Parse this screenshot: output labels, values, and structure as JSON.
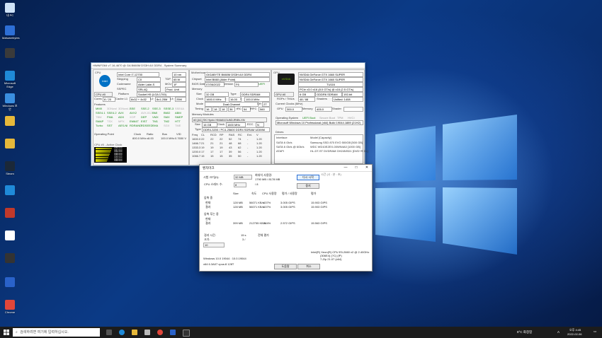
{
  "desktop": {
    "icons": [
      {
        "label": "내 PC",
        "color": "#cfe3f7"
      },
      {
        "label": "Malwarebytes",
        "color": "#2d6fd6"
      },
      {
        "label": "",
        "color": "#3a3a3a"
      },
      {
        "label": "Microsoft Edge",
        "color": "#1f8ad8"
      },
      {
        "label": "Windows 보안",
        "color": "#3a8fe0"
      },
      {
        "label": "",
        "color": "#e6b83a"
      },
      {
        "label": "",
        "color": "#e6b83a"
      },
      {
        "label": "Steam",
        "color": "#1b2838"
      },
      {
        "label": "",
        "color": "#1f8ad8"
      },
      {
        "label": "",
        "color": "#c0392b"
      },
      {
        "label": "",
        "color": "#ffffff"
      },
      {
        "label": "",
        "color": "#333333"
      },
      {
        "label": "",
        "color": "#2a62c9"
      },
      {
        "label": "Chrome",
        "color": "#e0463a"
      },
      {
        "label": "",
        "color": "#2a62c9"
      }
    ]
  },
  "hwinfo": {
    "title": "HWiNFO64 v7.16-4670 @ GA B660M DS3H AX DDR4 - System Summary",
    "cpu": {
      "header": "CPU",
      "name": "Intel Core i7-12700",
      "nm": "10 nm",
      "stepping": "Stepping",
      "stepping_val": "C0",
      "tdp_label": "TDP",
      "tdp": "65 W",
      "codename_label": "Codename",
      "codename": "Alder Lake-S",
      "mcu_label": "MCU",
      "mcu": "1F",
      "sspec_label": "SSPEC",
      "sspec": "SRL4Q",
      "prod_label": "Prod. Unit",
      "cpu_sel": "CPU #0",
      "platform_label": "Platform",
      "platform": "Socket H5 (LGA 1700)",
      "cores_label": "Cores",
      "cores": "8 / 20",
      "cache_label": "Cache L1",
      "cache_l1": "8x32 + 4x32",
      "l2_label": "L2",
      "l2": "8x1.25M",
      "l3_label": "L3",
      "l3": "25M",
      "features_label": "Features",
      "features": [
        "MMX",
        "3DNow!",
        "3DNow!-2",
        "SSE",
        "SSE-2",
        "SSE-3",
        "SSSE-3",
        "SSE4A",
        "SSE4.1",
        "SSE4.2",
        "AVX",
        "AVX2",
        "AVX-512",
        "BMI",
        "BMI2",
        "ABM",
        "TBM",
        "FMA",
        "ADX",
        "XOP",
        "DEP",
        "VMX",
        "SMX",
        "SMEP",
        "SMAP",
        "TSX",
        "MPX",
        "EM64T",
        "EIST",
        "TM1",
        "TM2",
        "HTT",
        "Turbo",
        "SST",
        "AES-NI",
        "RDRAND",
        "RDSEED",
        "SHA",
        "SGX",
        "TME"
      ],
      "op_point_label": "Operating Point",
      "clock_col": "Clock",
      "ratio_col": "Ratio",
      "bus_col": "Bus",
      "vid_col": "VID",
      "op_rows": [
        [
          "",
          "800.0 MHz",
          "x8.00",
          "100.0 MHz",
          "0.7650 V"
        ],
        [
          "",
          "2100.0 MHz",
          "x21.00",
          "100.0 MHz",
          ""
        ],
        [
          "",
          "4900.0 MHz",
          "x49.00",
          "100.0 MHz",
          ""
        ],
        [
          "",
          "4700.0 MHz",
          "x47.00",
          "100.0 MHz",
          "1.2880 V"
        ],
        [
          "",
          "4700.0 MHz",
          "x47.00",
          "99.8 MHz",
          ""
        ]
      ],
      "core_clock_label": "CPU #0 - Active Clock",
      "core_bars": [
        {
          "label": "Core 0",
          "value": "4988 MHz",
          "pct": 0.95
        },
        {
          "label": "Core 1",
          "value": "4987 MHz",
          "pct": 0.9
        },
        {
          "label": "Core 2",
          "value": "4988 MHz",
          "pct": 0.88
        },
        {
          "label": "Core 3",
          "value": "4988 MHz",
          "pct": 0.85
        },
        {
          "label": "Core 4",
          "value": "4988 MHz",
          "pct": 0.8
        },
        {
          "label": "Core 5",
          "value": "4988 MHz",
          "pct": 0.76
        },
        {
          "label": "Core 6",
          "value": "4988 MHz",
          "pct": 0.72
        },
        {
          "label": "Core 7",
          "value": "4988 MHz",
          "pct": 0.68
        }
      ]
    },
    "mobo": {
      "header": "Motherboard",
      "name": "GIGABYTE B660M DS3H AX DDR4",
      "chipset_label": "Chipset",
      "chipset": "Intel B660 (Alder Point)",
      "bios_label": "BIOS Date",
      "bios_date": "07/06/2022",
      "version_label": "Version",
      "version": "F6",
      "uefi": "UEFI",
      "memory_header": "Memory",
      "size_label": "Size",
      "size": "32 GB",
      "type_label": "Type",
      "type": "DDR4 SDRAM",
      "clock_label": "Clock",
      "clock": "1600.0 MHz",
      "eq": "=",
      "mult": "16.00",
      "x": "x",
      "base": "100.0 MHz",
      "mode_label": "Mode",
      "mode": "Dual-Channel",
      "cr_label": "CR",
      "cr": "2T",
      "timing_label": "Timing",
      "timings": [
        "16",
        "18",
        "18",
        "36"
      ],
      "trc_label": "tRC",
      "trc": "54",
      "trfc_label": "tRFC",
      "trfc": "560",
      "modules_header": "Memory Modules",
      "module_sel": "#0 [A1] SK Hynix HMA81GU6DJR8N-XN",
      "msize_label": "Size",
      "msize": "16 GB",
      "mclock_label": "Clock",
      "mclock": "1600 MHz",
      "ecc_label": "ECC",
      "ecc": "N",
      "mtype_label": "Type",
      "mtype": "DDR4-3200 / PC4-25600 DDR4 SDRAM UDIMM",
      "freq_cols": [
        "Freq",
        "CL",
        "RCD",
        "RP",
        "RAS",
        "RC",
        "Ext.",
        "V"
      ],
      "freq_rows": [
        [
          "1600.0",
          "22",
          "22",
          "22",
          "52",
          "74",
          "-",
          "1.20"
        ],
        [
          "1466.7",
          "21",
          "21",
          "21",
          "48",
          "68",
          "-",
          "1.20"
        ],
        [
          "1333.3",
          "19",
          "19",
          "19",
          "43",
          "62",
          "-",
          "1.20"
        ],
        [
          "1200.0",
          "17",
          "17",
          "17",
          "39",
          "56",
          "-",
          "1.20"
        ],
        [
          "1066.7",
          "15",
          "15",
          "15",
          "35",
          "50",
          "-",
          "1.20"
        ]
      ]
    },
    "gpu": {
      "header": "GPU",
      "name": "NVIDIA GeForce GTX 1660 SUPER",
      "sub": "NVIDIA GeForce GTX 1660 SUPER",
      "code": "TU116",
      "pcie": "PCIe v3.0 x16 (8.0 GT/s) @ x16 (2.5 GT/s)",
      "gpu_sel": "GPU #0",
      "vram": "6 GB",
      "vram_type": "GDDR6 SDRAM",
      "bus": "192-bit",
      "rops_label": "ROPs / TMUs",
      "rops": "48 / 88",
      "shaders_label": "Shaders",
      "shaders": "Unified: 1408",
      "clocks_label": "Current Clocks (MHz)",
      "gpu_clk_label": "GPU",
      "gpu_clk": "300.0",
      "mem_clk_label": "Memory",
      "mem_clk": "405.0",
      "shader_clk_label": "Shader",
      "shader_clk": "",
      "os_label": "Operating System",
      "uefi_boot": "UEFI Boot",
      "secure_boot": "Secure Boot",
      "tpm": "TPM",
      "hvci": "HVCI",
      "os": "Microsoft Windows 10 Professional (x64) Build 19044.1889 (21H2)",
      "drives_label": "Drives",
      "iface_col": "Interface",
      "model_col": "Model [Capacity]",
      "drives": [
        {
          "iface": "SATA 6 Gb/s",
          "model": "Samsung SSD 870 EVO 500GB [500 GB]"
        },
        {
          "iface": "SATA 6 Gb/s @ 6Gb/s",
          "model": "WDC WD10EZEX-00WN4A0 [1000 GB]"
        },
        {
          "iface": "ATAPI",
          "model": "HL-DT-ST DVDRAM GH24NSD1 [DVD+R DL]"
        }
      ]
    }
  },
  "dialog": {
    "title": "벤치마크",
    "min": "—",
    "max": "□",
    "close": "✕",
    "test_size_label": "시험 크기(D):",
    "test_size": "32 MB",
    "max_mem_label": "최대치 사용량:",
    "max_mem": "1790 MB / 8178 MB",
    "start_btn": "다시 시작",
    "threads_label": "CPU 스레드 수:",
    "threads": "8",
    "threads_of": "/ 8",
    "stop_btn": "중지",
    "result_note": "시간 (시 : 분 : 초)",
    "col_size": "Size",
    "col_speed": "속도",
    "col_cpu": "CPU 사용량",
    "col_rating": "평가 / 사용량",
    "col_eval": "평가",
    "compress_label": "압축 중",
    "current": "현재",
    "result": "결과",
    "compress_cur": [
      "128 MB",
      "56071 KB/s",
      "637%",
      "3.005 GIPS",
      "15.903 GIPS"
    ],
    "compress_res": [
      "128 MB",
      "56071 KB/s",
      "637%",
      "3.005 GIPS",
      "15.903 GIPS"
    ],
    "decompress_label": "압축 푸는 중",
    "decompress_cur": [
      "",
      "",
      "",
      "",
      ""
    ],
    "decompress_res": [
      "399 MB",
      "212755 KB/s",
      "784%",
      "2.572 GIPS",
      "15.563 GIPS"
    ],
    "elapsed_label": "경과 시간:",
    "elapsed": "15 s",
    "size_label": "크기:",
    "size": "3 /",
    "pass_label": "전체 평가",
    "passes": "10",
    "sys_info": "Intel(R) Xeon(R) CPU E5-2660 v2 @ 2.40GHz",
    "sys_info2": "(306E4) (?C) (IP)",
    "sys_info3": "7-Zip 21.07 (x64)",
    "os_line": "Windows 10.0 19044 : 10.0.19044",
    "cpu_line": "x64 6.3A07 cpus:8 128T",
    "help_btn": "도움말",
    "cancel_btn": "취소"
  },
  "taskbar": {
    "search_placeholder": "검색하려면 여기에 입력하십시오.",
    "weather": "8°C 화창함",
    "ime": "A",
    "time": "오후 4:45",
    "date": "2022-02-06"
  }
}
